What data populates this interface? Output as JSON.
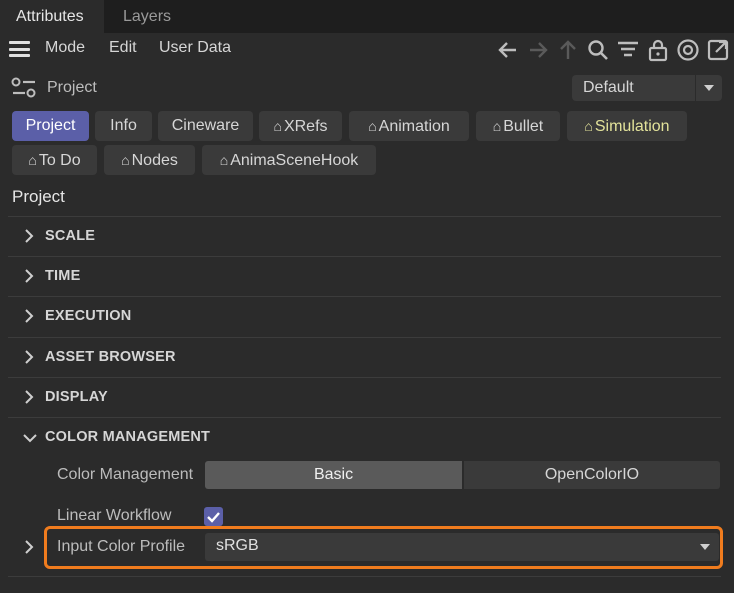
{
  "tabs": {
    "active": "Attributes",
    "inactive": "Layers"
  },
  "menu": {
    "mode": "Mode",
    "edit": "Edit",
    "user_data": "User Data"
  },
  "toolbar_icons": [
    "back-arrow-icon",
    "forward-arrow-icon",
    "up-arrow-icon",
    "search-icon",
    "filter-icon",
    "lock-icon",
    "target-icon",
    "new-window-icon"
  ],
  "header": {
    "title": "Project",
    "preset": "Default"
  },
  "pills": [
    {
      "label": "Project",
      "selected": true,
      "tag": false
    },
    {
      "label": "Info",
      "selected": false,
      "tag": false
    },
    {
      "label": "Cineware",
      "selected": false,
      "tag": false
    },
    {
      "label": "XRefs",
      "selected": false,
      "tag": true
    },
    {
      "label": "Animation",
      "selected": false,
      "tag": true
    },
    {
      "label": "Bullet",
      "selected": false,
      "tag": true
    },
    {
      "label": "Simulation",
      "selected": false,
      "tag": true
    },
    {
      "label": "To Do",
      "selected": false,
      "tag": true
    },
    {
      "label": "Nodes",
      "selected": false,
      "tag": true
    },
    {
      "label": "AnimaSceneHook",
      "selected": false,
      "tag": true
    }
  ],
  "section": {
    "title": "Project"
  },
  "groups": [
    "SCALE",
    "TIME",
    "EXECUTION",
    "ASSET BROWSER",
    "DISPLAY",
    "COLOR MANAGEMENT"
  ],
  "color_management": {
    "mode_label": "Color Management",
    "options": [
      "Basic",
      "OpenColorIO"
    ],
    "selected": "Basic",
    "linear_label": "Linear Workflow",
    "linear_checked": true,
    "input_profile_label": "Input Color Profile",
    "input_profile_value": "sRGB"
  },
  "colors": {
    "accent": "#5b5fa8",
    "highlight": "#f07c1e",
    "simulation": "#e2e29a"
  }
}
